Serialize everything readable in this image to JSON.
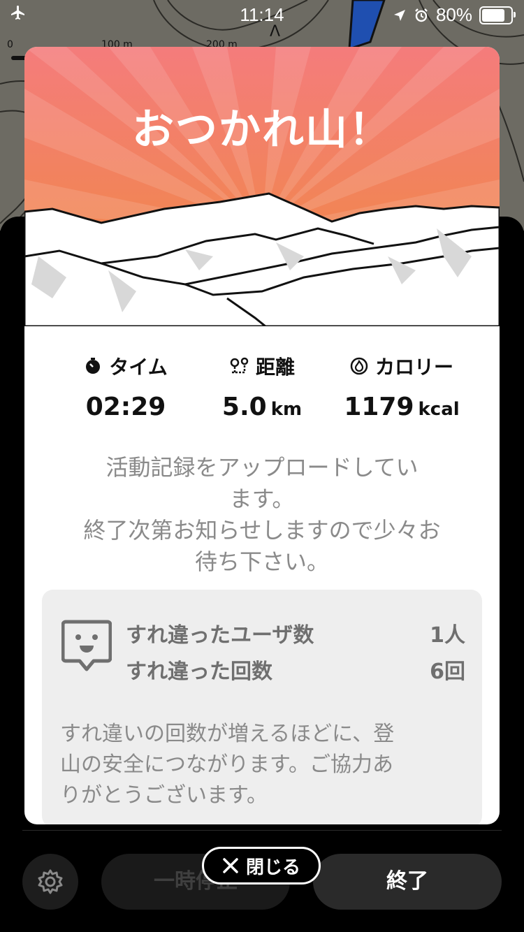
{
  "status_bar": {
    "time": "11:14",
    "battery_percent": "80%",
    "battery_level": 0.8,
    "icons": [
      "airplane-icon",
      "location-arrow-icon",
      "alarm-icon",
      "battery-icon"
    ]
  },
  "map": {
    "scale_labels": [
      "0",
      "100 m",
      "200 m"
    ]
  },
  "modal": {
    "title": "おつかれ山！",
    "hero_colors": {
      "top": "#f47c7c",
      "bottom": "#f08a3c"
    },
    "stats": [
      {
        "icon": "stopwatch-icon",
        "label": "タイム",
        "value": "02:29",
        "unit": ""
      },
      {
        "icon": "route-icon",
        "label": "距離",
        "value": "5.0",
        "unit": "km"
      },
      {
        "icon": "flame-icon",
        "label": "カロリー",
        "value": "1179",
        "unit": "kcal"
      }
    ],
    "upload_message_lines": [
      "活動記録をアップロードしてい",
      "ます。",
      "終了次第お知らせしますので少々お",
      "待ち下さい。"
    ],
    "encounter_panel": {
      "icon": "smiley-face-icon",
      "rows": [
        {
          "label": "すれ違ったユーザ数",
          "value": "1人"
        },
        {
          "label": "すれ違った回数",
          "value": "6回"
        }
      ],
      "note_lines": [
        "すれ違いの回数が増えるほどに、登",
        "山の安全につながります。ご協力あ",
        "りがとうございます。"
      ]
    }
  },
  "close_button": {
    "label": "閉じる",
    "icon": "close-icon"
  },
  "bottom_bar": {
    "settings_icon": "gear-icon",
    "pause_label": "一時停止",
    "end_label": "終了"
  }
}
